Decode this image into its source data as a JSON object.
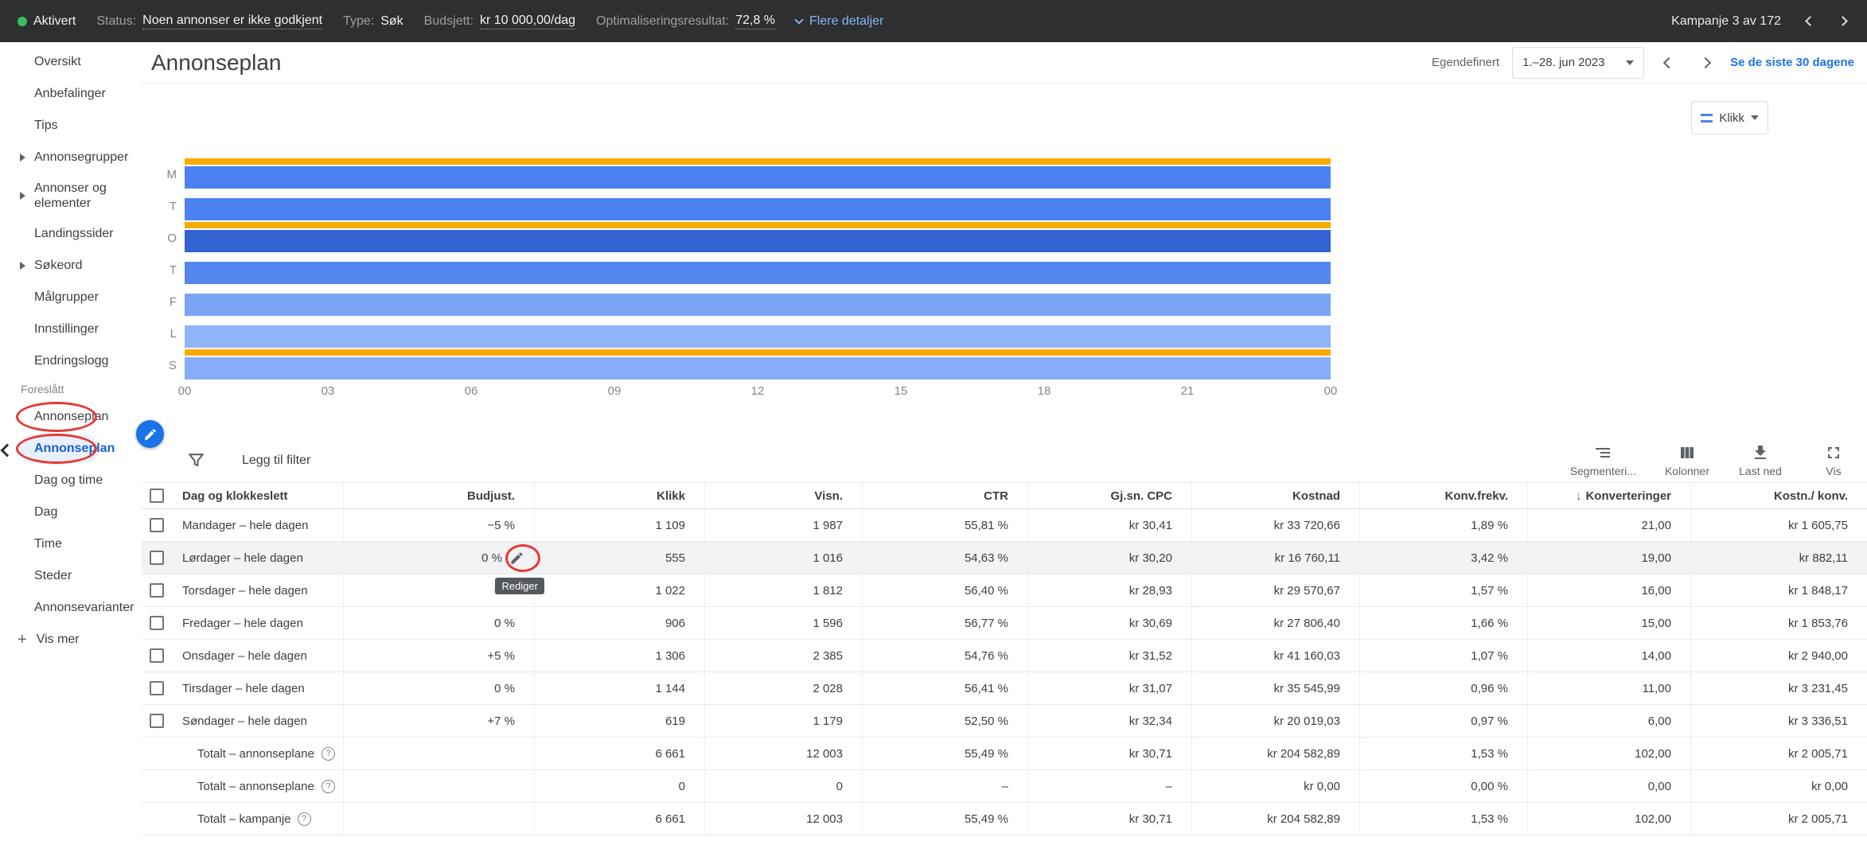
{
  "topbar": {
    "enabled": "Aktivert",
    "segments": [
      {
        "label": "Status:",
        "value": "Noen annonser er ikke godkjent",
        "dotted": true
      },
      {
        "label": "Type:",
        "value": "Søk",
        "dotted": false
      },
      {
        "label": "Budsjett:",
        "value": "kr 10 000,00/dag",
        "dotted": true
      },
      {
        "label": "Optimaliseringsresultat:",
        "value": "72,8 %",
        "dotted": true
      }
    ],
    "more_details": "Flere detaljer",
    "campaign_pager": "Kampanje 3 av 172"
  },
  "sidebar": {
    "items": [
      {
        "label": "Oversikt"
      },
      {
        "label": "Anbefalinger"
      },
      {
        "label": "Tips"
      },
      {
        "label": "Annonsegrupper",
        "expandable": true
      },
      {
        "label": "Annonser og elementer",
        "expandable": true,
        "wrap": true
      },
      {
        "label": "Landingssider"
      },
      {
        "label": "Søkeord",
        "expandable": true
      },
      {
        "label": "Målgrupper"
      },
      {
        "label": "Innstillinger"
      },
      {
        "label": "Endringslogg"
      }
    ],
    "section_label": "Foreslått",
    "suggested": [
      {
        "label": "Annonseplan",
        "annotated": true
      },
      {
        "label": "Annonseplan",
        "selected": true,
        "annotated": true
      },
      {
        "label": "Dag og time"
      },
      {
        "label": "Dag"
      },
      {
        "label": "Time"
      },
      {
        "label": "Steder"
      },
      {
        "label": "Annonsevarianter"
      }
    ],
    "show_more": "Vis mer"
  },
  "page": {
    "title": "Annonseplan",
    "date_mode": "Egendefinert",
    "date_range": "1.–28. jun 2023",
    "last_30": "Se de siste 30 dagene"
  },
  "legend_button": {
    "label": "Klikk",
    "icon": "series-color-chip"
  },
  "chart_data": {
    "type": "bar",
    "orientation": "horizontal",
    "title": "",
    "legend": [
      "Klikk"
    ],
    "categories": [
      "M",
      "T",
      "O",
      "T",
      "F",
      "L",
      "S"
    ],
    "series": [
      {
        "name": "Klikk",
        "values": [
          1109,
          1144,
          1306,
          1022,
          906,
          555,
          619
        ]
      }
    ],
    "x_ticks": [
      "00",
      "03",
      "06",
      "09",
      "12",
      "15",
      "18",
      "21",
      "00"
    ],
    "bars_span": "full-day-00-to-00",
    "bar_colors": [
      "#4c82ef",
      "#4c82ef",
      "#3263d0",
      "#5586ef",
      "#7aa3f4",
      "#90b4f8",
      "#86adf6"
    ],
    "adjustment_rows": [
      true,
      false,
      true,
      false,
      false,
      false,
      true
    ],
    "adjustment_color": "#f9ab00"
  },
  "filter_bar": {
    "add_filter": "Legg til filter",
    "tools": [
      {
        "label": "Segmenteri...",
        "icon": "segment-icon"
      },
      {
        "label": "Kolonner",
        "icon": "columns-icon"
      },
      {
        "label": "Last ned",
        "icon": "download-icon"
      },
      {
        "label": "Vis",
        "icon": "expand-icon"
      }
    ]
  },
  "table": {
    "columns": [
      "Dag og klokkeslett",
      "Budjust.",
      "Klikk",
      "Visn.",
      "CTR",
      "Gj.sn. CPC",
      "Kostnad",
      "Konv.frekv.",
      "Konverteringer",
      "Kostn./ konv."
    ],
    "sorted_column": "Konverteringer",
    "edit_tooltip": "Rediger",
    "rows": [
      {
        "name": "Mandager – hele dagen",
        "values": [
          "−5 %",
          "1 109",
          "1 987",
          "55,81 %",
          "kr 30,41",
          "kr 33 720,66",
          "1,89 %",
          "21,00",
          "kr 1 605,75"
        ]
      },
      {
        "name": "Lørdager – hele dagen",
        "hover": true,
        "edit": true,
        "values": [
          "0 %",
          "555",
          "1 016",
          "54,63 %",
          "kr 30,20",
          "kr 16 760,11",
          "3,42 %",
          "19,00",
          "kr 882,11"
        ]
      },
      {
        "name": "Torsdager – hele dagen",
        "values": [
          "0 %",
          "1 022",
          "1 812",
          "56,40 %",
          "kr 28,93",
          "kr 29 570,67",
          "1,57 %",
          "16,00",
          "kr 1 848,17"
        ]
      },
      {
        "name": "Fredager – hele dagen",
        "values": [
          "0 %",
          "906",
          "1 596",
          "56,77 %",
          "kr 30,69",
          "kr 27 806,40",
          "1,66 %",
          "15,00",
          "kr 1 853,76"
        ]
      },
      {
        "name": "Onsdager – hele dagen",
        "values": [
          "+5 %",
          "1 306",
          "2 385",
          "54,76 %",
          "kr 31,52",
          "kr 41 160,03",
          "1,07 %",
          "14,00",
          "kr 2 940,00"
        ]
      },
      {
        "name": "Tirsdager – hele dagen",
        "values": [
          "0 %",
          "1 144",
          "2 028",
          "56,41 %",
          "kr 31,07",
          "kr 35 545,99",
          "0,96 %",
          "11,00",
          "kr 3 231,45"
        ]
      },
      {
        "name": "Søndager – hele dagen",
        "values": [
          "+7 %",
          "619",
          "1 179",
          "52,50 %",
          "kr 32,34",
          "kr 20 019,03",
          "0,97 %",
          "6,00",
          "kr 3 336,51"
        ]
      }
    ],
    "totals": [
      {
        "name": "Totalt – annonseplaner",
        "values": [
          "",
          "6 661",
          "12 003",
          "55,49 %",
          "kr 30,71",
          "kr 204 582,89",
          "1,53 %",
          "102,00",
          "kr 2 005,71"
        ]
      },
      {
        "name": "Totalt – annonseplaner som er fj...",
        "values": [
          "",
          "0",
          "0",
          "–",
          "–",
          "kr 0,00",
          "0,00 %",
          "0,00",
          "kr 0,00"
        ]
      },
      {
        "name": "Totalt – kampanje",
        "values": [
          "",
          "6 661",
          "12 003",
          "55,49 %",
          "kr 30,71",
          "kr 204 582,89",
          "1,53 %",
          "102,00",
          "kr 2 005,71"
        ]
      }
    ]
  },
  "annotations": {
    "color": "#e53935",
    "targets": [
      "sidebar-annonseplan-1",
      "sidebar-annonseplan-2",
      "lordager-edit-pencil"
    ]
  },
  "colors": {
    "accent": "#1a73e8",
    "topbar_link": "#8ab4f8",
    "enabled_green": "#3dbd5c",
    "adjustment_orange": "#f9ab00"
  }
}
